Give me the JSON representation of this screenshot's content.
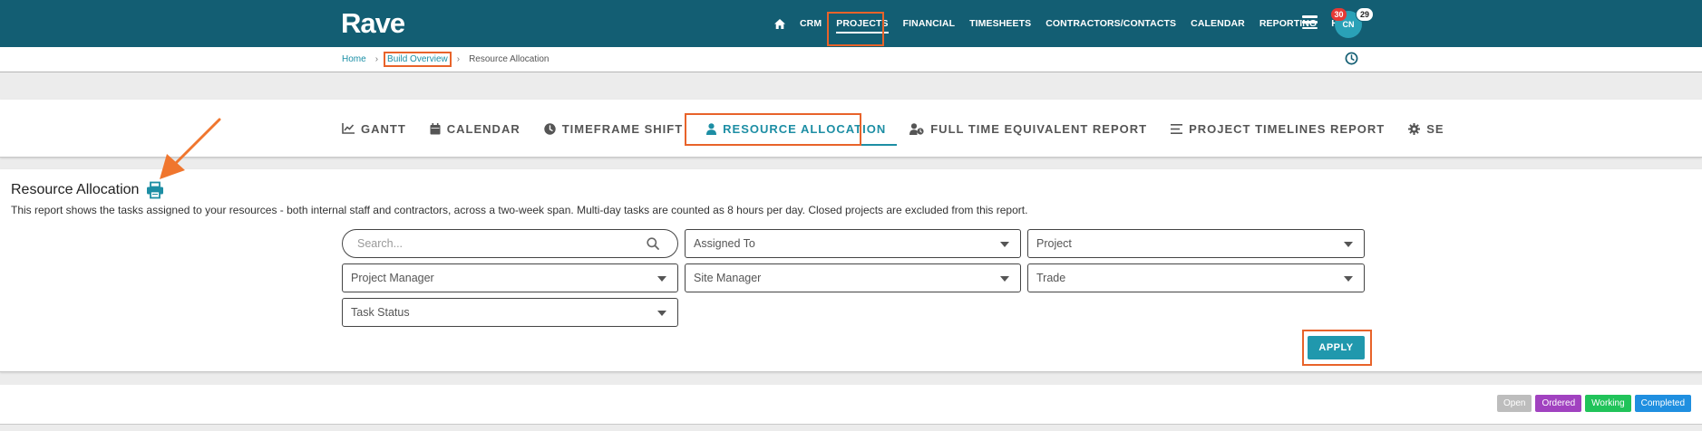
{
  "app": {
    "logo": "Rave"
  },
  "nav": {
    "items": [
      {
        "label": "CRM"
      },
      {
        "label": "PROJECTS"
      },
      {
        "label": "FINANCIAL"
      },
      {
        "label": "TIMESHEETS"
      },
      {
        "label": "CONTRACTORS/CONTACTS"
      },
      {
        "label": "CALENDAR"
      },
      {
        "label": "REPORTING"
      },
      {
        "label": "HELP"
      }
    ],
    "avatar_initials": "CN",
    "notification_count": "30",
    "message_count": "29"
  },
  "breadcrumb": {
    "home": "Home",
    "parent": "Build Overview",
    "current": "Resource Allocation"
  },
  "tabs": [
    {
      "label": "GANTT",
      "icon": "chart-line-icon"
    },
    {
      "label": "CALENDAR",
      "icon": "calendar-icon"
    },
    {
      "label": "TIMEFRAME SHIFT",
      "icon": "clock-icon"
    },
    {
      "label": "RESOURCE ALLOCATION",
      "icon": "user-icon",
      "active": true
    },
    {
      "label": "FULL TIME EQUIVALENT REPORT",
      "icon": "user-clock-icon"
    },
    {
      "label": "PROJECT TIMELINES REPORT",
      "icon": "list-icon"
    },
    {
      "label": "SE",
      "icon": "gear-icon"
    }
  ],
  "page": {
    "title": "Resource Allocation",
    "description": "This report shows the tasks assigned to your resources - both internal staff and contractors, across a two-week span. Multi-day tasks are counted as 8 hours per day. Closed projects are excluded from this report."
  },
  "filters": {
    "search_placeholder": "Search...",
    "assigned_to": "Assigned To",
    "project": "Project",
    "project_manager": "Project Manager",
    "site_manager": "Site Manager",
    "trade": "Trade",
    "task_status": "Task Status",
    "apply_label": "APPLY"
  },
  "legend": [
    {
      "label": "Open",
      "color": "#bdbdbd"
    },
    {
      "label": "Ordered",
      "color": "#a142c0"
    },
    {
      "label": "Working",
      "color": "#21c35a"
    },
    {
      "label": "Completed",
      "color": "#1f8fe0"
    }
  ],
  "colors": {
    "topbar": "#135e73",
    "accent": "#1d8ea4",
    "highlight": "#e8632a"
  }
}
